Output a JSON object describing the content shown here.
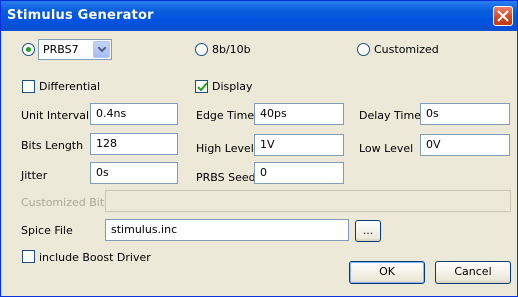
{
  "window": {
    "title": "Stimulus Generator"
  },
  "mode": {
    "options": [
      {
        "label": "PRBS7",
        "selected": true
      },
      {
        "label": "8b/10b",
        "selected": false
      },
      {
        "label": "Customized",
        "selected": false
      }
    ],
    "prbs_select_value": "PRBS7"
  },
  "toggles": {
    "differential": {
      "label": "Differential",
      "checked": false
    },
    "display": {
      "label": "Display",
      "checked": true
    },
    "boost": {
      "label": "include Boost Driver",
      "checked": false
    }
  },
  "fields": {
    "unit_interval": {
      "label": "Unit Interval",
      "value": "0.4ns"
    },
    "edge_time": {
      "label": "Edge Time",
      "value": "40ps"
    },
    "delay_time": {
      "label": "Delay Time",
      "value": "0s"
    },
    "bits_length": {
      "label": "Bits Length",
      "value": "128"
    },
    "high_level": {
      "label": "High Level",
      "value": "1V"
    },
    "low_level": {
      "label": "Low Level",
      "value": "0V"
    },
    "jitter": {
      "label": "Jitter",
      "value": "0s"
    },
    "prbs_seed": {
      "label": "PRBS Seed",
      "value": "0"
    },
    "customized_bits": {
      "label": "Customized Bits",
      "value": "",
      "enabled": false
    },
    "spice_file": {
      "label": "Spice File",
      "value": "stimulus.inc"
    }
  },
  "buttons": {
    "browse": "...",
    "ok": "OK",
    "cancel": "Cancel"
  },
  "colors": {
    "titlebar": "#0054e3",
    "dialog_bg": "#ece9d8",
    "close": "#d2451c",
    "radio_dot": "#21a121",
    "check_mark": "#21a121"
  }
}
